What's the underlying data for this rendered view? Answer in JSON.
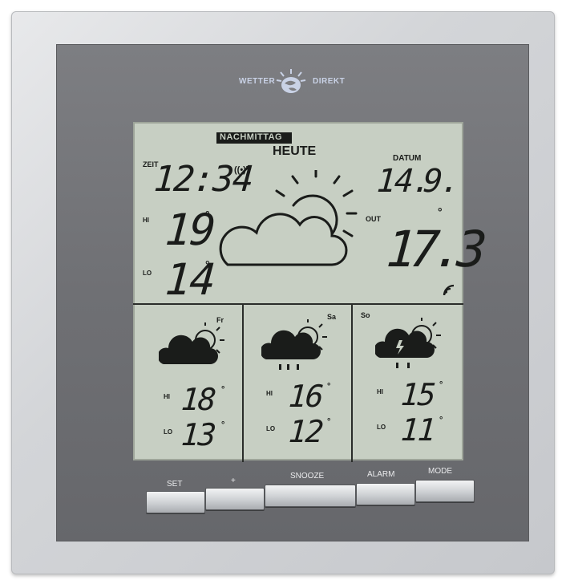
{
  "brand": {
    "left": "WETTER",
    "right": "DIREKT"
  },
  "lcd": {
    "period_label": "NACHMITTAG",
    "day_label": "HEUTE",
    "time_label": "ZEIT",
    "time": "12:34",
    "radio_signal": "((•))",
    "date_label": "DATUM",
    "date_day": "14.",
    "date_month": "9.",
    "hi_label": "HI",
    "hi_value": "19",
    "lo_label": "LO",
    "lo_value": "14",
    "out_label": "OUT",
    "out_temp": "17.3",
    "degree": "°",
    "today_icon": "sun-behind-cloud-icon"
  },
  "forecast": [
    {
      "day": "Fr",
      "icon": "dark-cloud-sun-icon",
      "hi_label": "HI",
      "hi": "18",
      "lo_label": "LO",
      "lo": "13"
    },
    {
      "day": "Sa",
      "icon": "rain-cloud-sun-icon",
      "hi_label": "HI",
      "hi": "16",
      "lo_label": "LO",
      "lo": "12"
    },
    {
      "day": "So",
      "icon": "thunder-rain-cloud-sun-icon",
      "hi_label": "HI",
      "hi": "15",
      "lo_label": "LO",
      "lo": "11"
    }
  ],
  "buttons": {
    "set": "SET",
    "plus": "+",
    "snooze": "SNOOZE",
    "alarm": "ALARM",
    "mode": "MODE"
  },
  "colors": {
    "lcd_bg": "#c7cfc3",
    "segment": "#1a1c1a",
    "panel": "#707175",
    "frame": "#d3d5d8"
  }
}
